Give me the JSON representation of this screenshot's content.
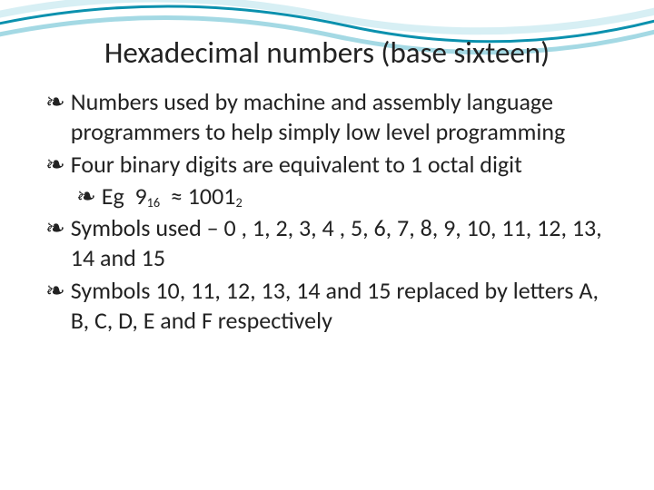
{
  "title": "Hexadecimal numbers (base sixteen)",
  "bullets": [
    "Numbers used by machine and assembly language programmers to help simply low level programming",
    "Four binary digits are equivalent to 1 octal digit",
    "Eg  9₁₆  ≈ 1001₂",
    "Symbols used – 0 , 1, 2, 3, 4 , 5, 6, 7, 8, 9, 10, 11, 12, 13, 14 and 15",
    "Symbols 10, 11, 12, 13, 14 and 15 replaced by letters A, B, C, D, E and F respectively"
  ],
  "marker": "❧"
}
